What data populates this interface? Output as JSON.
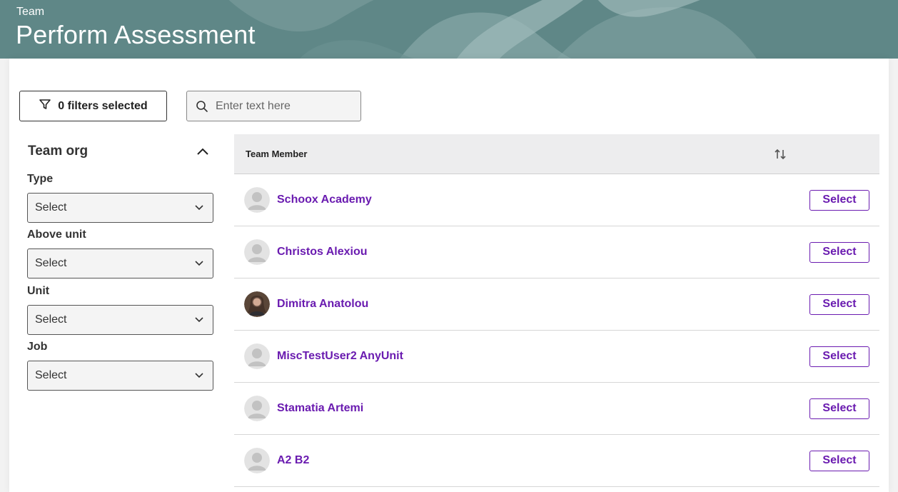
{
  "header": {
    "eyebrow": "Team",
    "title": "Perform Assessment",
    "background_color": "#5f8787"
  },
  "toolbar": {
    "filters_label": "0 filters selected",
    "filter_icon": "filter-funnel-icon",
    "search_icon": "search-icon",
    "search_placeholder": "Enter text here",
    "search_value": ""
  },
  "sidebar": {
    "title": "Team org",
    "collapse_icon": "chevron-up-icon",
    "filters": [
      {
        "label": "Type",
        "value": "Select"
      },
      {
        "label": "Above unit",
        "value": "Select"
      },
      {
        "label": "Unit",
        "value": "Select"
      },
      {
        "label": "Job",
        "value": "Select"
      }
    ]
  },
  "table": {
    "column_header": "Team Member",
    "sort_icon": "sort-arrows-icon",
    "accent_color": "#6a1bb0",
    "rows": [
      {
        "name": "Schoox Academy",
        "action": "Select",
        "avatar": "default"
      },
      {
        "name": "Christos Alexiou",
        "action": "Select",
        "avatar": "default"
      },
      {
        "name": "Dimitra Anatolou",
        "action": "Select",
        "avatar": "photo"
      },
      {
        "name": "MiscTestUser2 AnyUnit",
        "action": "Select",
        "avatar": "default"
      },
      {
        "name": "Stamatia Artemi",
        "action": "Select",
        "avatar": "default"
      },
      {
        "name": "A2 B2",
        "action": "Select",
        "avatar": "default"
      }
    ]
  }
}
